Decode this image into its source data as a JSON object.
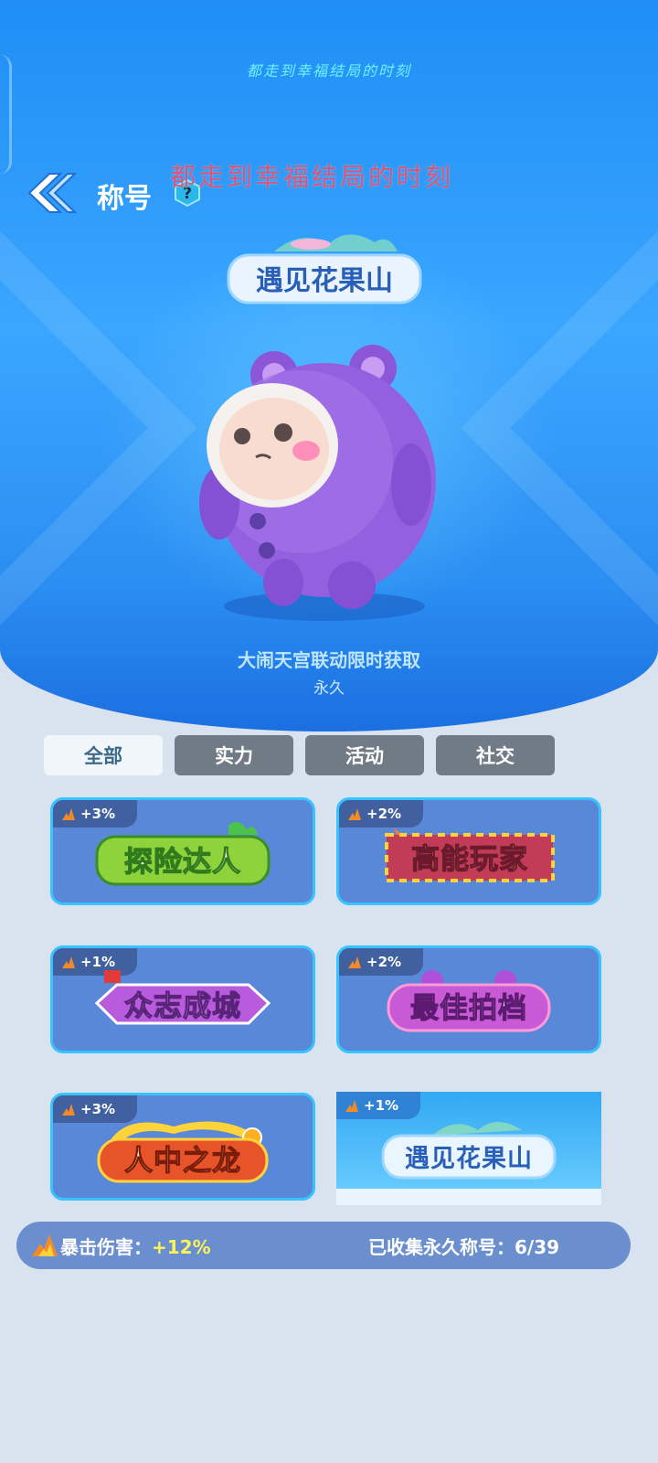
{
  "top_caption": "都走到幸福结局的时刻",
  "overlay_caption": "都走到幸福结局的时刻",
  "header": {
    "title": "称号",
    "help_label": "?"
  },
  "featured": {
    "title_art": "遇见花果山",
    "description": "大闹天宫联动限时获取",
    "duration": "永久"
  },
  "tabs": [
    {
      "label": "全部",
      "active": true
    },
    {
      "label": "实力",
      "active": false
    },
    {
      "label": "活动",
      "active": false
    },
    {
      "label": "社交",
      "active": false
    }
  ],
  "titles": [
    {
      "name": "探险达人",
      "bonus": "+3%",
      "selected": false
    },
    {
      "name": "高能玩家",
      "bonus": "+2%",
      "selected": false
    },
    {
      "name": "众志成城",
      "bonus": "+1%",
      "selected": false
    },
    {
      "name": "最佳拍档",
      "bonus": "+2%",
      "selected": false
    },
    {
      "name": "人中之龙",
      "bonus": "+3%",
      "selected": false
    },
    {
      "name": "遇见花果山",
      "bonus": "+1%",
      "selected": true
    }
  ],
  "stats": {
    "crit_label": "暴击伤害：",
    "crit_value": "+12%",
    "collected_label": "已收集永久称号：",
    "collected_value": "6/39"
  },
  "colors": {
    "accent_cyan": "#37c3ff",
    "card_bg": "#5a88d8",
    "bonus_yellow": "#f8f35a"
  }
}
